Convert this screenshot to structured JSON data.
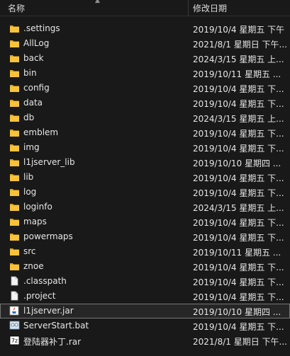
{
  "header": {
    "name_label": "名称",
    "date_label": "修改日期",
    "sort_glyph": "▲"
  },
  "colors": {
    "folder": "#f8c33a",
    "folder_dark": "#e0a820",
    "background": "#191919",
    "text": "#e6e6e6"
  },
  "files": [
    {
      "name": ".settings",
      "modified": "2019/10/4 星期五 下午",
      "type": "folder-icon"
    },
    {
      "name": "AllLog",
      "modified": "2021/8/1 星期日 下午...",
      "type": "folder-icon"
    },
    {
      "name": "back",
      "modified": "2024/3/15 星期五 上...",
      "type": "folder-icon"
    },
    {
      "name": "bin",
      "modified": "2019/10/11 星期五 ...",
      "type": "folder-icon"
    },
    {
      "name": "config",
      "modified": "2019/10/4 星期五 下...",
      "type": "folder-icon"
    },
    {
      "name": "data",
      "modified": "2019/10/4 星期五 下...",
      "type": "folder-icon"
    },
    {
      "name": "db",
      "modified": "2024/3/15 星期五 上...",
      "type": "folder-icon"
    },
    {
      "name": "emblem",
      "modified": "2019/10/4 星期五 下...",
      "type": "folder-icon"
    },
    {
      "name": "img",
      "modified": "2019/10/4 星期五 下...",
      "type": "folder-icon"
    },
    {
      "name": "l1jserver_lib",
      "modified": "2019/10/10 星期四 ...",
      "type": "folder-icon"
    },
    {
      "name": "lib",
      "modified": "2019/10/4 星期五 下...",
      "type": "folder-icon"
    },
    {
      "name": "log",
      "modified": "2019/10/4 星期五 下...",
      "type": "folder-icon"
    },
    {
      "name": "loginfo",
      "modified": "2024/3/15 星期五 上...",
      "type": "folder-icon"
    },
    {
      "name": "maps",
      "modified": "2019/10/4 星期五 下...",
      "type": "folder-icon"
    },
    {
      "name": "powermaps",
      "modified": "2019/10/4 星期五 下...",
      "type": "folder-icon"
    },
    {
      "name": "src",
      "modified": "2019/10/11 星期五 ...",
      "type": "folder-icon"
    },
    {
      "name": "znoe",
      "modified": "2019/10/4 星期五 下...",
      "type": "folder-icon"
    },
    {
      "name": ".classpath",
      "modified": "2019/10/4 星期五 下...",
      "type": "file-icon"
    },
    {
      "name": ".project",
      "modified": "2019/10/4 星期五 下...",
      "type": "file-icon"
    },
    {
      "name": "l1jserver.jar",
      "modified": "2019/10/10 星期四 ...",
      "type": "jar-icon",
      "selected": true
    },
    {
      "name": "ServerStart.bat",
      "modified": "2019/10/4 星期五 下...",
      "type": "bat-icon"
    },
    {
      "name": "登陆器补丁.rar",
      "modified": "2021/8/1 星期日 下午...",
      "type": "rar-icon"
    }
  ]
}
